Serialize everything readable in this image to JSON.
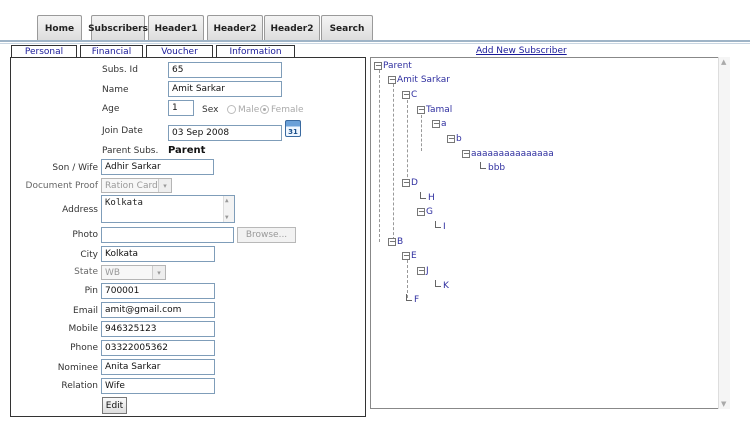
{
  "top_tabs": [
    "Home",
    "Subscribers",
    "Header1",
    "Header2",
    "Header2",
    "Search"
  ],
  "sub_tabs": [
    "Personal",
    "Financial",
    "Voucher",
    "Information"
  ],
  "add_link": "Add New Subscriber",
  "form": {
    "subs_id_label": "Subs. Id",
    "subs_id_value": "65",
    "name_label": "Name",
    "name_value": "Amit Sarkar",
    "age_label": "Age",
    "age_value": "1",
    "sex_label": "Sex",
    "sex_male": "Male",
    "sex_female": "Female",
    "join_label": "Join Date",
    "join_value": "03 Sep 2008",
    "calendar_day": "31",
    "parent_label": "Parent Subs.",
    "parent_value": "Parent",
    "son_label": "Son / Wife",
    "son_value": "Adhir Sarkar",
    "doc_label": "Document Proof",
    "doc_value": "Ration Card",
    "address_label": "Address",
    "address_value": "Kolkata",
    "photo_label": "Photo",
    "photo_value": "",
    "browse_label": "Browse...",
    "city_label": "City",
    "city_value": "Kolkata",
    "state_label": "State",
    "state_value": "WB",
    "pin_label": "Pin",
    "pin_value": "700001",
    "email_label": "Email",
    "email_value": "amit@gmail.com",
    "mobile_label": "Mobile",
    "mobile_value": "946325123",
    "phone_label": "Phone",
    "phone_value": "03322005362",
    "nominee_label": "Nominee",
    "nominee_value": "Anita Sarkar",
    "relation_label": "Relation",
    "relation_value": "Wife",
    "edit_label": "Edit"
  },
  "tree": {
    "nodes": [
      "Parent",
      "Amit Sarkar",
      "C",
      "Tamal",
      "a",
      "b",
      "aaaaaaaaaaaaaaa",
      "bbb",
      "D",
      "H",
      "G",
      "I",
      "B",
      "E",
      "J",
      "K",
      "F"
    ]
  },
  "colors": {
    "link": "#1a1a99",
    "tab_bg": "#dcdcdc",
    "border": "#333333"
  }
}
